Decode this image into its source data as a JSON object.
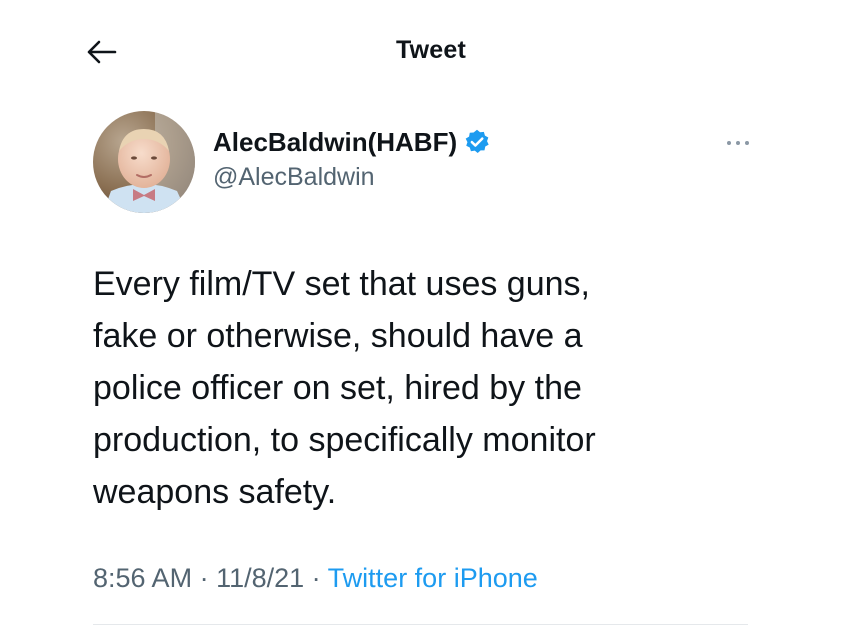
{
  "header": {
    "title": "Tweet",
    "back_icon": "arrow-left-icon"
  },
  "tweet": {
    "author": {
      "display_name": "AlecBaldwin(HABF)",
      "handle": "@AlecBaldwin",
      "verified": true,
      "verified_icon": "verified-badge-icon"
    },
    "more_icon": "more-horizontal-icon",
    "text": "Every film/TV set that uses guns,\nfake or otherwise, should have a\npolice officer on set, hired by the\nproduction, to specifically monitor\nweapons safety.",
    "time": "8:56 AM",
    "separator": " · ",
    "date": "11/8/21",
    "source": "Twitter for iPhone"
  },
  "colors": {
    "text_primary": "#0f1419",
    "text_secondary": "#536471",
    "accent": "#1d9bf0",
    "divider": "#e5e8eb"
  }
}
